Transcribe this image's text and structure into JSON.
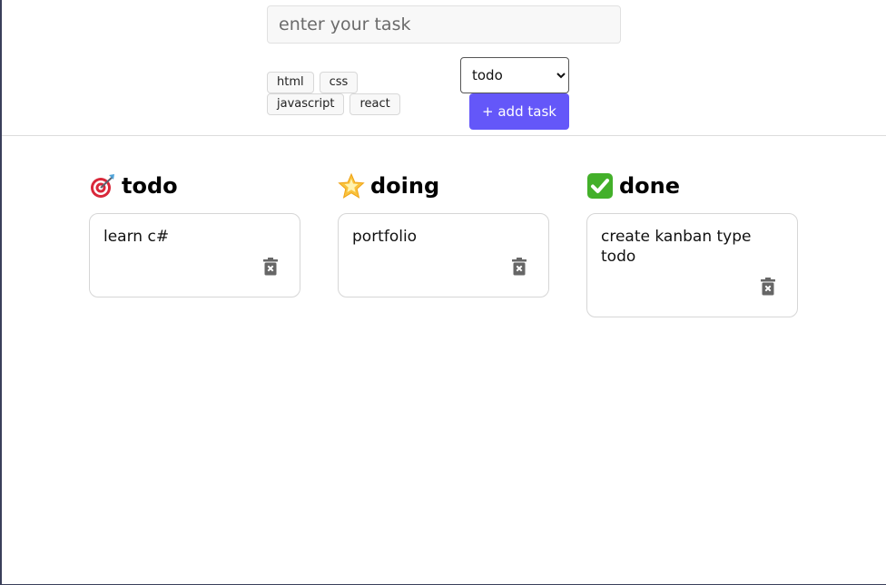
{
  "form": {
    "task_placeholder": "enter your task",
    "task_value": "",
    "tags": [
      "html",
      "css",
      "javascript",
      "react"
    ],
    "status_options": [
      "todo",
      "doing",
      "done"
    ],
    "status_selected": "todo",
    "add_button_label": "+ add task",
    "accent_color": "#6457f9"
  },
  "columns": [
    {
      "title": "todo",
      "icon": "target-icon",
      "cards": [
        {
          "text": "learn c#"
        }
      ]
    },
    {
      "title": "doing",
      "icon": "star-icon",
      "cards": [
        {
          "text": "portfolio"
        }
      ]
    },
    {
      "title": "done",
      "icon": "check-icon",
      "cards": [
        {
          "text": "create kanban type todo"
        }
      ]
    }
  ]
}
